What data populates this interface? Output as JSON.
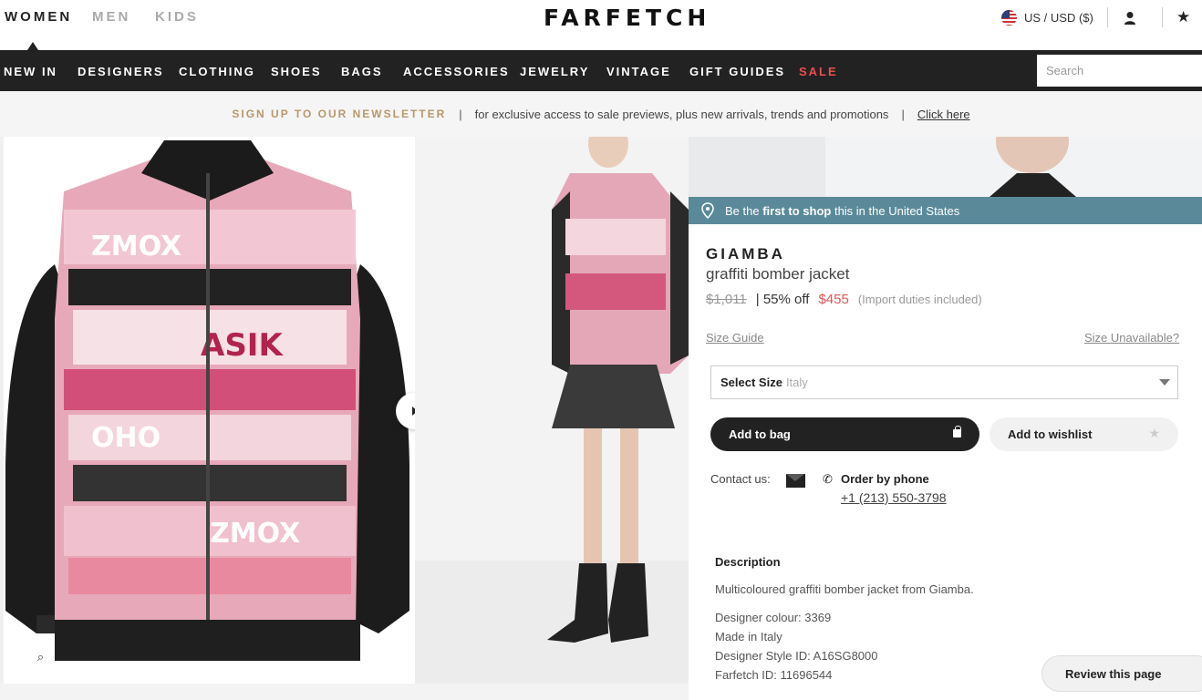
{
  "header": {
    "genders": [
      "WOMEN",
      "MEN",
      "KIDS"
    ],
    "logo": "FARFETCH",
    "region": "US / USD ($)"
  },
  "nav": {
    "items": [
      "NEW IN",
      "DESIGNERS",
      "CLOTHING",
      "SHOES",
      "BAGS",
      "ACCESSORIES",
      "JEWELRY",
      "VINTAGE",
      "GIFT GUIDES",
      "SALE"
    ],
    "search_placeholder": "Search"
  },
  "newsletter": {
    "title": "SIGN UP TO OUR NEWSLETTER",
    "separator": "|",
    "text": "for exclusive access to sale previews, plus new arrivals, trends and promotions",
    "link": "Click here"
  },
  "banner": {
    "prefix": "Be the",
    "bold": "first to shop",
    "suffix": "this in the United States"
  },
  "product": {
    "designer": "GIAMBA",
    "name": "graffiti bomber jacket",
    "old_price": "$1,011",
    "discount": "| 55% off",
    "price": "$455",
    "duties": "(Import duties included)"
  },
  "size": {
    "guide": "Size Guide",
    "unavailable": "Size Unavailable?",
    "select_label": "Select Size",
    "select_sub": "Italy"
  },
  "actions": {
    "add_to_bag": "Add to bag",
    "add_to_wishlist": "Add to wishlist"
  },
  "contact": {
    "label": "Contact us:",
    "order_by_phone": "Order by phone",
    "phone": "+1 (213) 550-3798"
  },
  "description": {
    "title": "Description",
    "lines": [
      "Multicoloured graffiti bomber jacket from Giamba.",
      "Designer colour: 3369",
      "Made in Italy",
      "Designer Style ID: A16SG8000",
      "Farfetch ID: 11696544"
    ]
  },
  "review": "Review this page"
}
